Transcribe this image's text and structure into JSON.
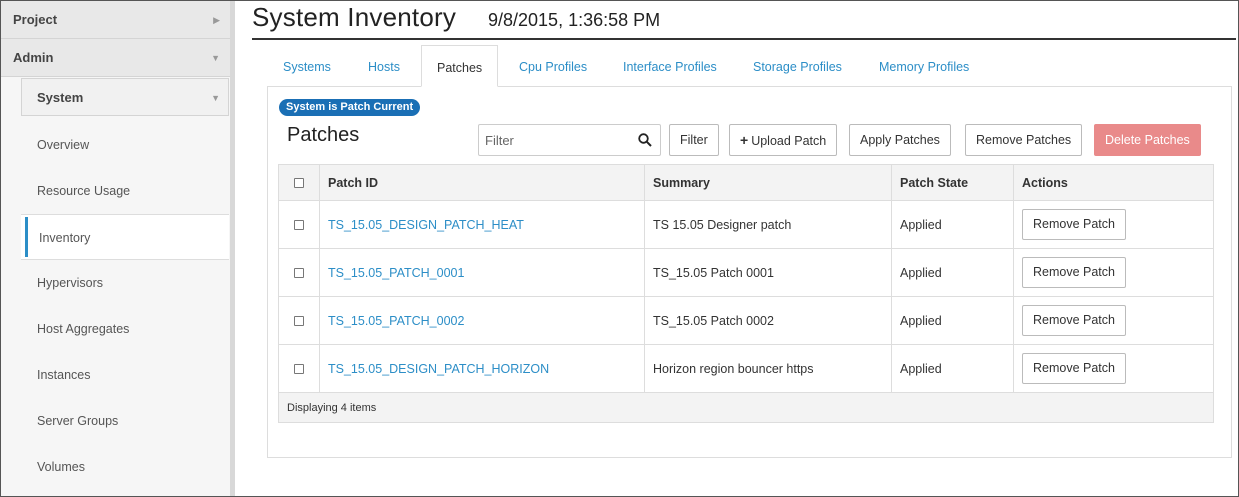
{
  "sidebar": {
    "project_label": "Project",
    "admin_label": "Admin",
    "system_label": "System",
    "items": [
      {
        "label": "Overview"
      },
      {
        "label": "Resource Usage"
      },
      {
        "label": "Inventory"
      },
      {
        "label": "Hypervisors"
      },
      {
        "label": "Host Aggregates"
      },
      {
        "label": "Instances"
      },
      {
        "label": "Server Groups"
      },
      {
        "label": "Volumes"
      }
    ],
    "active_item": "Inventory"
  },
  "header": {
    "title": "System Inventory",
    "timestamp": "9/8/2015, 1:36:58 PM"
  },
  "tabs": [
    {
      "label": "Systems"
    },
    {
      "label": "Hosts"
    },
    {
      "label": "Patches"
    },
    {
      "label": "Cpu Profiles"
    },
    {
      "label": "Interface Profiles"
    },
    {
      "label": "Storage Profiles"
    },
    {
      "label": "Memory Profiles"
    }
  ],
  "active_tab": "Patches",
  "panel": {
    "status_badge": "System is Patch Current",
    "title": "Patches",
    "filter_placeholder": "Filter",
    "buttons": {
      "filter": "Filter",
      "upload": "Upload Patch",
      "apply": "Apply Patches",
      "remove": "Remove Patches",
      "delete": "Delete Patches"
    },
    "columns": [
      "Patch ID",
      "Summary",
      "Patch State",
      "Actions"
    ],
    "rows": [
      {
        "id": "TS_15.05_DESIGN_PATCH_HEAT",
        "summary": "TS 15.05 Designer patch",
        "state": "Applied",
        "action": "Remove Patch"
      },
      {
        "id": "TS_15.05_PATCH_0001",
        "summary": "TS_15.05 Patch 0001",
        "state": "Applied",
        "action": "Remove Patch"
      },
      {
        "id": "TS_15.05_PATCH_0002",
        "summary": "TS_15.05 Patch 0002",
        "state": "Applied",
        "action": "Remove Patch"
      },
      {
        "id": "TS_15.05_DESIGN_PATCH_HORIZON",
        "summary": "Horizon region bouncer https",
        "state": "Applied",
        "action": "Remove Patch"
      }
    ],
    "footer": "Displaying 4 items"
  },
  "colors": {
    "link": "#2c8ec7",
    "badge": "#1a6fb5",
    "danger_button": "#e98a8a"
  }
}
